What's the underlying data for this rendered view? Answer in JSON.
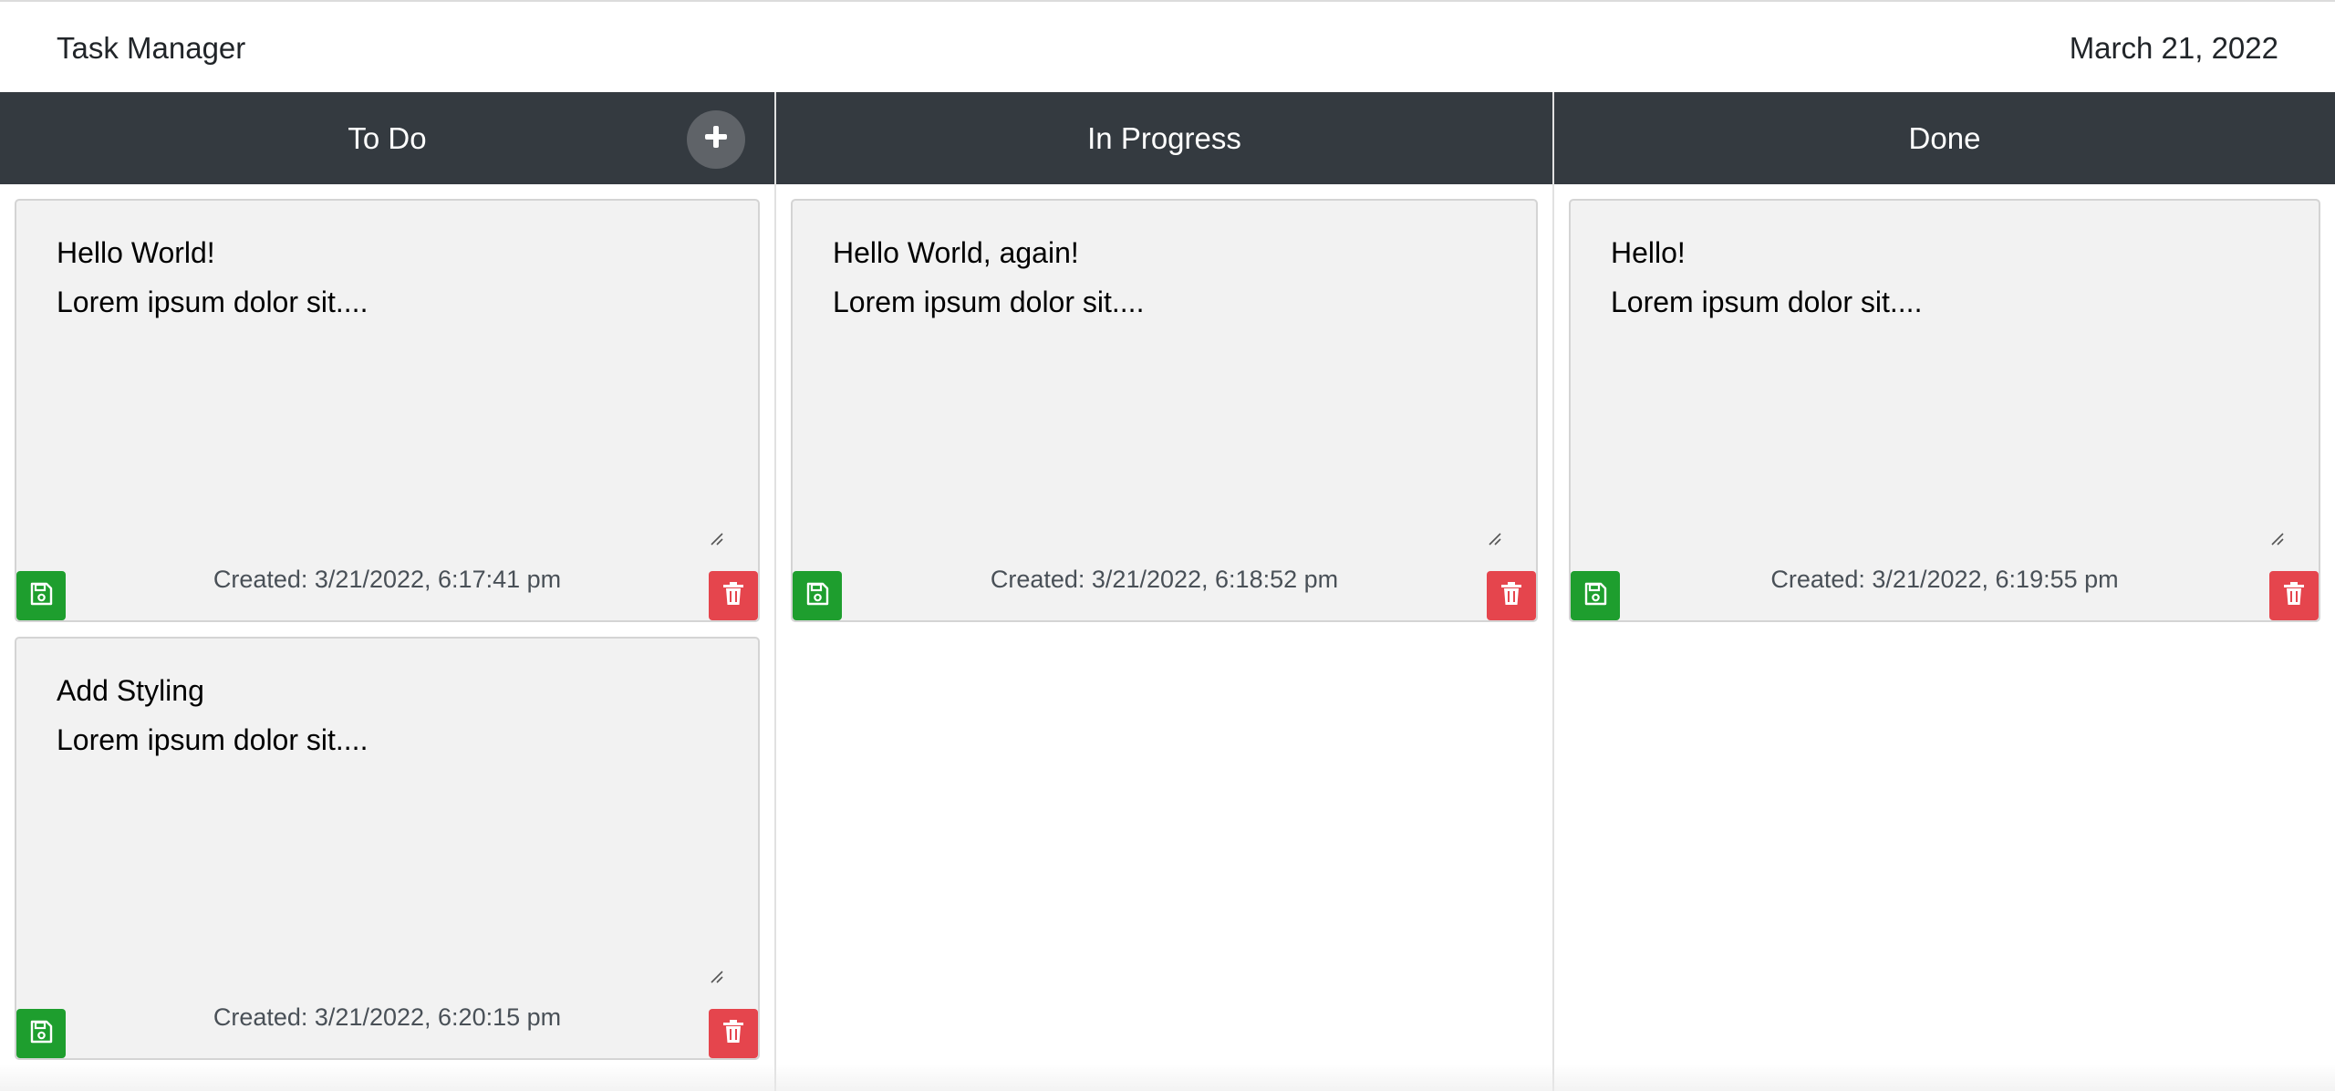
{
  "header": {
    "title": "Task Manager",
    "date": "March 21, 2022"
  },
  "columns": [
    {
      "title": "To Do",
      "add_icon": "plus-icon",
      "cards": [
        {
          "title": "Hello World!",
          "body": "Lorem ipsum dolor sit....",
          "created": "Created: 3/21/2022, 6:17:41 pm"
        },
        {
          "title": "Add Styling",
          "body": "Lorem ipsum dolor sit....",
          "created": "Created: 3/21/2022, 6:20:15 pm"
        }
      ]
    },
    {
      "title": "In Progress",
      "cards": [
        {
          "title": "Hello World, again!",
          "body": "Lorem ipsum dolor sit....",
          "created": "Created: 3/21/2022, 6:18:52 pm"
        }
      ]
    },
    {
      "title": "Done",
      "cards": [
        {
          "title": "Hello!",
          "body": "Lorem ipsum dolor sit....",
          "created": "Created: 3/21/2022, 6:19:55 pm"
        }
      ]
    }
  ],
  "icons": {
    "save": "floppy-disk-icon",
    "delete": "trash-icon",
    "add": "plus-icon"
  },
  "colors": {
    "header_bg": "#343a40",
    "save": "#1e9e2e",
    "delete": "#e5454d",
    "card_bg": "#f2f2f2"
  }
}
